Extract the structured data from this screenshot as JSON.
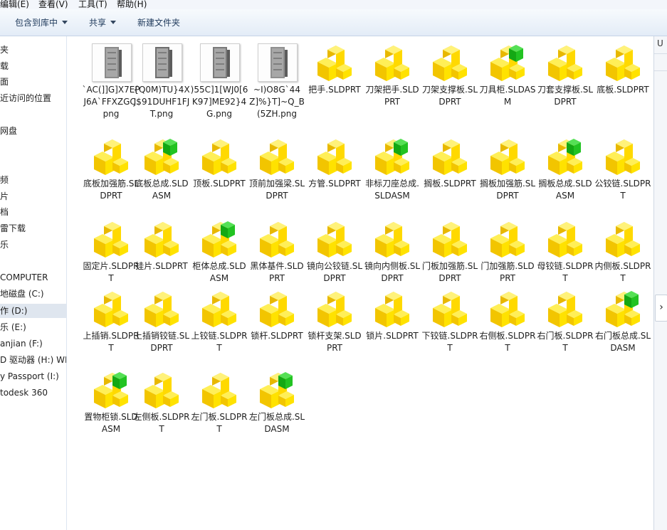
{
  "menu": [
    "编辑(E)",
    "查看(V)",
    "工具(T)",
    "帮助(H)"
  ],
  "toolbar": {
    "include_library": "包含到库中",
    "share": "共享",
    "new_folder": "新建文件夹"
  },
  "nav": [
    "夹",
    "载",
    "面",
    "近访问的位置",
    "",
    "网盘",
    "",
    "",
    "频",
    "片",
    "档",
    "雷下载",
    "乐",
    "",
    "COMPUTER",
    "地磁盘 (C:)",
    "作 (D:)",
    "乐 (E:)",
    "anjian (F:)",
    "D 驱动器 (H:) WD",
    "y Passport (I:)",
    "todesk 360"
  ],
  "selected_nav_index": 16,
  "detail_header": "U",
  "files": [
    {
      "name": "`AC(]]G]X7EPJ6A`FFXZGC.png",
      "type": "png"
    },
    {
      "name": "{Q0M)TU}4XJ$91DUHF1FJT.png",
      "type": "png"
    },
    {
      "name": ")55C]1[WJ0[6K97]ME92}4G.png",
      "type": "png"
    },
    {
      "name": "~I)O8G`44Z]%}T]~Q_B(5ZH.png",
      "type": "png"
    },
    {
      "name": "把手.SLDPRT",
      "type": "part"
    },
    {
      "name": "刀架把手.SLDPRT",
      "type": "part"
    },
    {
      "name": "刀架支撑板.SLDPRT",
      "type": "part"
    },
    {
      "name": "刀具柜.SLDASM",
      "type": "asm"
    },
    {
      "name": "刀套支撑板.SLDPRT",
      "type": "part"
    },
    {
      "name": "底板.SLDPRT",
      "type": "part"
    },
    {
      "name": "底板加强筋.SLDPRT",
      "type": "part"
    },
    {
      "name": "底板总成.SLDASM",
      "type": "asm"
    },
    {
      "name": "顶板.SLDPRT",
      "type": "part"
    },
    {
      "name": "顶前加强梁.SLDPRT",
      "type": "part"
    },
    {
      "name": "方管.SLDPRT",
      "type": "part"
    },
    {
      "name": "非标刀座总成.SLDASM",
      "type": "asm"
    },
    {
      "name": "搁板.SLDPRT",
      "type": "part"
    },
    {
      "name": "搁板加强筋.SLDPRT",
      "type": "part"
    },
    {
      "name": "搁板总成.SLDASM",
      "type": "asm"
    },
    {
      "name": "公铰链.SLDPRT",
      "type": "part"
    },
    {
      "name": "固定片.SLDPRT",
      "type": "part"
    },
    {
      "name": "挂片.SLDPRT",
      "type": "part"
    },
    {
      "name": "柜体总成.SLDASM",
      "type": "asm"
    },
    {
      "name": "黑体基件.SLDPRT",
      "type": "part"
    },
    {
      "name": "镜向公铰链.SLDPRT",
      "type": "part"
    },
    {
      "name": "镜向内侧板.SLDPRT",
      "type": "part"
    },
    {
      "name": "门板加强筋.SLDPRT",
      "type": "part"
    },
    {
      "name": "门加强筋.SLDPRT",
      "type": "part"
    },
    {
      "name": "母铰链.SLDPRT",
      "type": "part"
    },
    {
      "name": "内侧板.SLDPRT",
      "type": "part"
    },
    {
      "name": "上插销.SLDPRT",
      "type": "part"
    },
    {
      "name": "上插销铰链.SLDPRT",
      "type": "part"
    },
    {
      "name": "上铰链.SLDPRT",
      "type": "part"
    },
    {
      "name": "锁杆.SLDPRT",
      "type": "part"
    },
    {
      "name": "锁杆支架.SLDPRT",
      "type": "part"
    },
    {
      "name": "锁片.SLDPRT",
      "type": "part"
    },
    {
      "name": "下铰链.SLDPRT",
      "type": "part"
    },
    {
      "name": "右侧板.SLDPRT",
      "type": "part"
    },
    {
      "name": "右门板.SLDPRT",
      "type": "part"
    },
    {
      "name": "右门板总成.SLDASM",
      "type": "asm"
    },
    {
      "name": "置物柜锁.SLDASM",
      "type": "asm"
    },
    {
      "name": "左侧板.SLDPRT",
      "type": "part"
    },
    {
      "name": "左门板.SLDPRT",
      "type": "part"
    },
    {
      "name": "左门板总成.SLDASM",
      "type": "asm"
    }
  ],
  "colors": {
    "part_yellow": "#ffe600",
    "asm_green": "#22c322",
    "selection": "#dfe6ef"
  }
}
